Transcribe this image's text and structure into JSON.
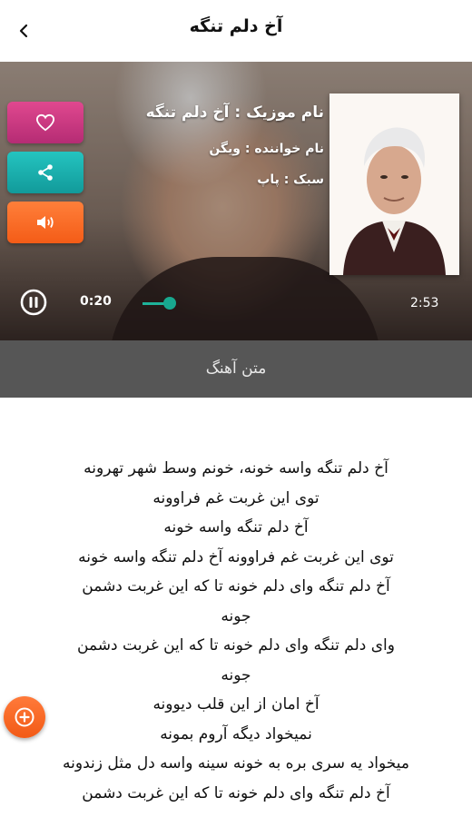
{
  "header": {
    "title": "آخ دلم تنگه",
    "back_icon": "chevron-left-icon"
  },
  "player": {
    "name_line": "نام موزیک : آخ دلم تنگه",
    "singer_line": "نام خواننده : ویگن",
    "genre_line": "سبک : پاپ",
    "elapsed": "0:20",
    "duration": "2:53",
    "progress_fraction": 0.115,
    "actions": [
      {
        "name": "favorite",
        "icon": "heart-icon",
        "color": "#cf3a82"
      },
      {
        "name": "share",
        "icon": "share-icon",
        "color": "#1fb5b3"
      },
      {
        "name": "volume",
        "icon": "speaker-icon",
        "color": "#fb6c28"
      }
    ],
    "play_state_icon": "pause-icon",
    "accent": "#1eb39a"
  },
  "lyrics_bar": {
    "label": "متن آهنگ"
  },
  "lyrics": [
    "آخ دلم تنگه واسه خونه، خونم وسط شهر تهرونه",
    "توی این غربت غم فراوونه",
    "آخ دلم تنگه واسه خونه",
    "توی این غربت غم فراوونه آخ دلم تنگه واسه خونه",
    "آخ دلم تنگه وای دلم خونه تا که این غربت دشمن",
    "جونه",
    "وای دلم تنگه وای دلم خونه تا که این غربت دشمن",
    "جونه",
    "آخ امان از این قلب دیوونه",
    "نمیخواد دیگه آروم بمونه",
    "میخواد یه سری بره به خونه سینه واسه دل مثل زندونه",
    "آخ دلم تنگه وای دلم خونه تا که این غربت دشمن"
  ],
  "fab": {
    "icon": "plus-icon",
    "color": "#f4621c"
  }
}
